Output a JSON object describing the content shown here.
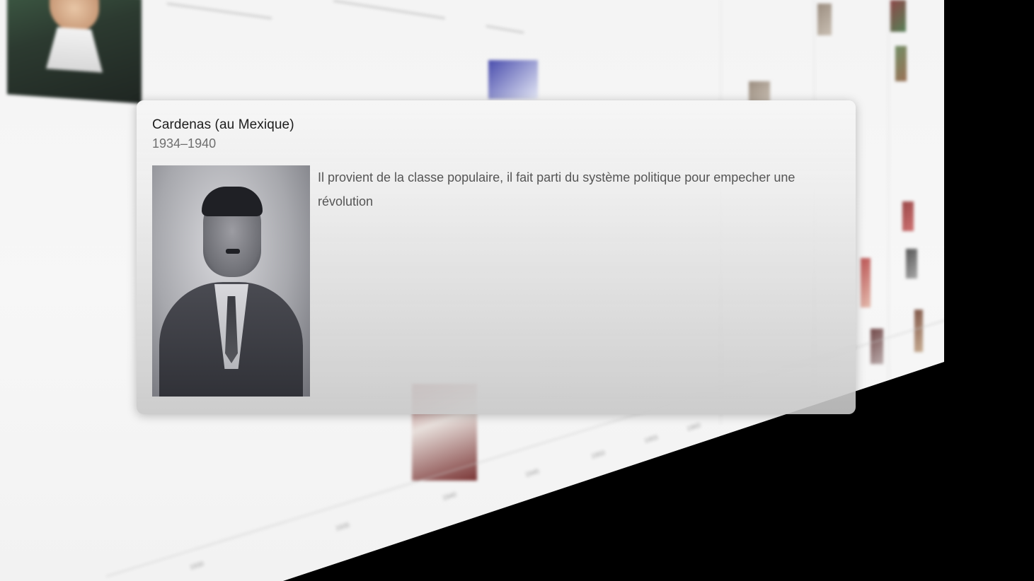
{
  "popup": {
    "title": "Cardenas (au Mexique)",
    "dates": "1934–1940",
    "description": "Il provient de la classe populaire, il fait parti du système politique pour empecher une révolution",
    "photo_icon": "portrait-photo"
  },
  "colors": {
    "card_bg": "#f0f0f0",
    "title": "#1c1c1c",
    "date": "#6e6e6e",
    "text": "#555555",
    "backdrop": "#000000"
  }
}
